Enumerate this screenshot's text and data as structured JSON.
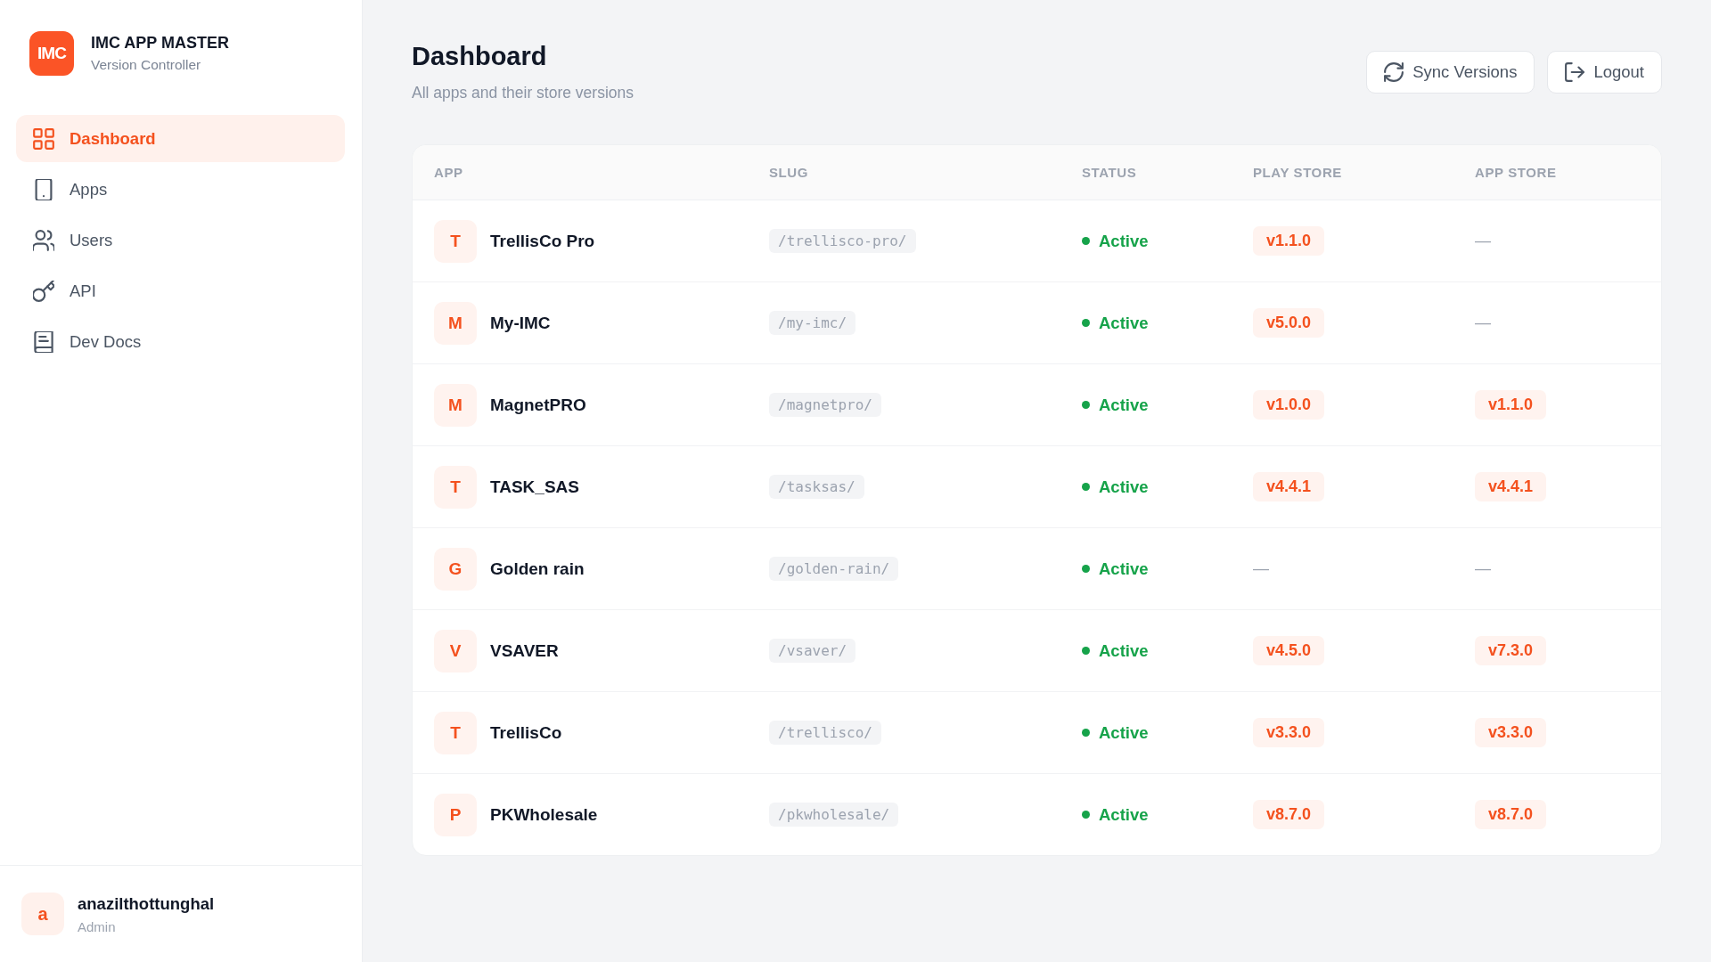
{
  "sidebar": {
    "logo": "IMC",
    "title": "IMC APP MASTER",
    "subtitle": "Version Controller",
    "items": [
      {
        "label": "Dashboard",
        "selected": true
      },
      {
        "label": "Apps",
        "selected": false
      },
      {
        "label": "Users",
        "selected": false
      },
      {
        "label": "API",
        "selected": false
      },
      {
        "label": "Dev Docs",
        "selected": false
      }
    ],
    "user": {
      "avatar": "a",
      "name": "anazilthottunghal",
      "role": "Admin"
    }
  },
  "header": {
    "title": "Dashboard",
    "subtitle": "All apps and their store versions",
    "actions": [
      {
        "label": "Sync Versions"
      },
      {
        "label": "Logout"
      }
    ]
  },
  "table": {
    "columns": [
      "APP",
      "SLUG",
      "STATUS",
      "PLAY STORE",
      "APP STORE"
    ],
    "rows": [
      {
        "initial": "T",
        "name": "TrellisCo Pro",
        "slug": "/trellisco-pro/",
        "status": "Active",
        "play_store": {
          "text": "v1.1.0",
          "kind": "version"
        },
        "app_store": {
          "text": "—",
          "kind": "none"
        }
      },
      {
        "initial": "M",
        "name": "My-IMC",
        "slug": "/my-imc/",
        "status": "Active",
        "play_store": {
          "text": "v5.0.0",
          "kind": "version"
        },
        "app_store": {
          "text": "—",
          "kind": "none"
        }
      },
      {
        "initial": "M",
        "name": "MagnetPRO",
        "slug": "/magnetpro/",
        "status": "Active",
        "play_store": {
          "text": "v1.0.0",
          "kind": "version"
        },
        "app_store": {
          "text": "v1.1.0",
          "kind": "version"
        }
      },
      {
        "initial": "T",
        "name": "TASK_SAS",
        "slug": "/tasksas/",
        "status": "Active",
        "play_store": {
          "text": "v4.4.1",
          "kind": "version"
        },
        "app_store": {
          "text": "v4.4.1",
          "kind": "version"
        }
      },
      {
        "initial": "G",
        "name": "Golden rain",
        "slug": "/golden-rain/",
        "status": "Active",
        "play_store": {
          "text": "—",
          "kind": "none"
        },
        "app_store": {
          "text": "—",
          "kind": "none"
        }
      },
      {
        "initial": "V",
        "name": "VSAVER",
        "slug": "/vsaver/",
        "status": "Active",
        "play_store": {
          "text": "v4.5.0",
          "kind": "version"
        },
        "app_store": {
          "text": "v7.3.0",
          "kind": "version"
        }
      },
      {
        "initial": "T",
        "name": "TrellisCo",
        "slug": "/trellisco/",
        "status": "Active",
        "play_store": {
          "text": "v3.3.0",
          "kind": "version"
        },
        "app_store": {
          "text": "v3.3.0",
          "kind": "version"
        }
      },
      {
        "initial": "P",
        "name": "PKWholesale",
        "slug": "/pkwholesale/",
        "status": "Active",
        "play_store": {
          "text": "v8.7.0",
          "kind": "version"
        },
        "app_store": {
          "text": "v8.7.0",
          "kind": "version"
        }
      }
    ]
  }
}
